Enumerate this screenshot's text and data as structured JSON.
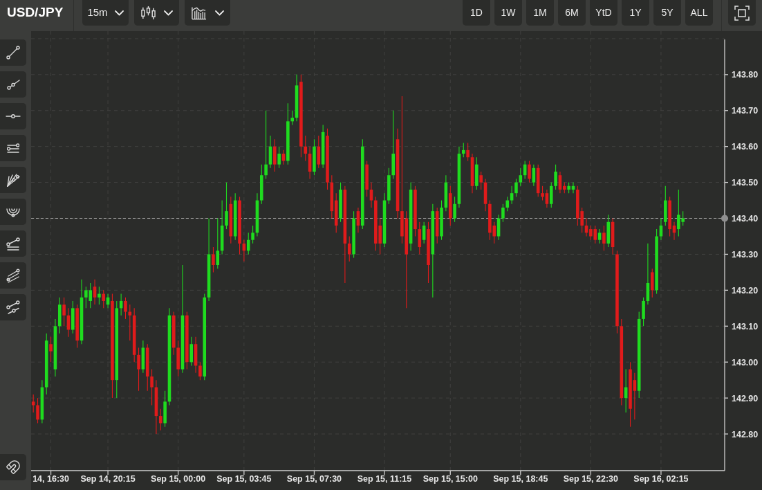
{
  "header": {
    "symbol": "USD/JPY",
    "interval": "15m",
    "ranges": [
      "1D",
      "1W",
      "1M",
      "6M",
      "YtD",
      "1Y",
      "5Y",
      "ALL"
    ]
  },
  "chart": {
    "chart_data": {
      "type": "candlestick",
      "grid": true,
      "ylim": [
        142.698,
        143.921
      ],
      "yticks": [
        {
          "value": 143.8,
          "label": "143.80"
        },
        {
          "value": 143.7,
          "label": "143.70"
        },
        {
          "value": 143.6,
          "label": "143.60"
        },
        {
          "value": 143.5,
          "label": "143.50"
        },
        {
          "value": 143.4,
          "label": "143.40"
        },
        {
          "value": 143.3,
          "label": "143.30"
        },
        {
          "value": 143.2,
          "label": "143.20"
        },
        {
          "value": 143.1,
          "label": "143.10"
        },
        {
          "value": 143.0,
          "label": "143.00"
        },
        {
          "value": 142.9,
          "label": "142.90"
        },
        {
          "value": 142.8,
          "label": "142.80"
        }
      ],
      "ref_lines": [
        {
          "axis": "y",
          "value": 143.4
        }
      ],
      "categories": [
        null,
        null,
        null,
        null,
        "14, 16:30",
        null,
        null,
        null,
        null,
        null,
        null,
        null,
        null,
        null,
        null,
        null,
        null,
        "Sep 14, 20:15",
        null,
        null,
        null,
        null,
        null,
        null,
        null,
        null,
        null,
        null,
        null,
        null,
        null,
        null,
        null,
        "Sep 15, 00:00",
        null,
        null,
        null,
        null,
        null,
        null,
        null,
        null,
        null,
        null,
        null,
        null,
        null,
        null,
        "Sep 15, 03:45",
        null,
        null,
        null,
        null,
        null,
        null,
        null,
        null,
        null,
        null,
        null,
        null,
        null,
        null,
        null,
        "Sep 15, 07:30",
        null,
        null,
        null,
        null,
        null,
        null,
        null,
        null,
        null,
        null,
        null,
        null,
        null,
        null,
        null,
        "Sep 15, 11:15",
        null,
        null,
        null,
        null,
        null,
        null,
        null,
        null,
        null,
        null,
        null,
        null,
        null,
        null,
        "Sep 15, 15:00",
        null,
        null,
        null,
        null,
        null,
        null,
        null,
        null,
        null,
        null,
        null,
        null,
        null,
        null,
        null,
        "Sep 15, 18:45",
        null,
        null,
        null,
        null,
        null,
        null,
        null,
        null,
        null,
        null,
        null,
        null,
        null,
        null,
        null,
        "Sep 15, 22:30",
        null,
        null,
        null,
        null,
        null,
        null,
        null,
        null,
        null,
        null,
        null,
        null,
        null,
        null,
        null,
        "Sep 16, 02:15",
        null,
        null,
        null,
        null,
        null,
        null,
        null,
        null,
        null,
        null,
        null,
        null,
        null,
        null
      ],
      "ohlc": [
        [
          142.89,
          142.91,
          142.86,
          142.88
        ],
        [
          142.88,
          142.9,
          142.83,
          142.84
        ],
        [
          142.84,
          142.95,
          142.83,
          142.93
        ],
        [
          142.93,
          143.08,
          142.91,
          143.06
        ],
        [
          143.05,
          143.07,
          143.0,
          143.03
        ],
        [
          142.98,
          143.12,
          142.96,
          143.1
        ],
        [
          143.1,
          143.18,
          143.08,
          143.16
        ],
        [
          143.16,
          143.18,
          143.1,
          143.13
        ],
        [
          143.13,
          143.15,
          143.07,
          143.09
        ],
        [
          143.09,
          143.17,
          143.08,
          143.15
        ],
        [
          143.15,
          143.16,
          143.04,
          143.06
        ],
        [
          143.06,
          143.23,
          143.05,
          143.18
        ],
        [
          143.18,
          143.21,
          143.15,
          143.2
        ],
        [
          143.17,
          143.22,
          143.15,
          143.2
        ],
        [
          143.21,
          143.23,
          143.16,
          143.18
        ],
        [
          143.18,
          143.21,
          143.16,
          143.19
        ],
        [
          143.19,
          143.2,
          143.15,
          143.17
        ],
        [
          143.16,
          143.19,
          143.15,
          143.18
        ],
        [
          143.17,
          143.19,
          142.9,
          142.95
        ],
        [
          142.95,
          143.17,
          142.9,
          143.15
        ],
        [
          143.15,
          143.19,
          143.13,
          143.17
        ],
        [
          143.17,
          143.18,
          143.12,
          143.14
        ],
        [
          143.14,
          143.16,
          143.06,
          143.13
        ],
        [
          143.13,
          143.15,
          143.0,
          143.02
        ],
        [
          143.02,
          143.04,
          142.92,
          142.98
        ],
        [
          142.98,
          143.06,
          142.97,
          143.04
        ],
        [
          143.04,
          143.05,
          142.92,
          142.96
        ],
        [
          142.96,
          142.98,
          142.88,
          142.93
        ],
        [
          142.93,
          142.95,
          142.8,
          142.85
        ],
        [
          142.85,
          142.87,
          142.81,
          142.83
        ],
        [
          142.83,
          142.92,
          142.82,
          142.89
        ],
        [
          142.89,
          143.15,
          142.88,
          143.13
        ],
        [
          143.13,
          143.14,
          143.02,
          143.04
        ],
        [
          143.04,
          143.06,
          142.96,
          142.98
        ],
        [
          142.98,
          143.27,
          142.97,
          143.13
        ],
        [
          143.13,
          143.14,
          142.98,
          143.0
        ],
        [
          143.0,
          143.07,
          142.99,
          143.05
        ],
        [
          143.05,
          143.07,
          142.97,
          142.99
        ],
        [
          142.99,
          143.0,
          142.95,
          142.96
        ],
        [
          142.96,
          143.19,
          142.95,
          143.18
        ],
        [
          143.18,
          143.4,
          143.17,
          143.3
        ],
        [
          143.3,
          143.32,
          143.25,
          143.27
        ],
        [
          143.27,
          143.4,
          143.26,
          143.31
        ],
        [
          143.31,
          143.45,
          143.3,
          143.38
        ],
        [
          143.38,
          143.5,
          143.37,
          143.42
        ],
        [
          143.44,
          143.46,
          143.33,
          143.35
        ],
        [
          143.35,
          143.47,
          143.34,
          143.45
        ],
        [
          143.45,
          143.46,
          143.3,
          143.33
        ],
        [
          143.33,
          143.34,
          143.28,
          143.31
        ],
        [
          143.31,
          143.36,
          143.3,
          143.34
        ],
        [
          143.34,
          143.38,
          143.33,
          143.36
        ],
        [
          143.36,
          143.47,
          143.35,
          143.45
        ],
        [
          143.45,
          143.55,
          143.44,
          143.52
        ],
        [
          143.52,
          143.7,
          143.51,
          143.55
        ],
        [
          143.55,
          143.63,
          143.54,
          143.6
        ],
        [
          143.6,
          143.62,
          143.53,
          143.55
        ],
        [
          143.55,
          143.6,
          143.54,
          143.58
        ],
        [
          143.58,
          143.59,
          143.55,
          143.56
        ],
        [
          143.56,
          143.72,
          143.55,
          143.67
        ],
        [
          143.67,
          143.7,
          143.66,
          143.68
        ],
        [
          143.68,
          143.8,
          143.67,
          143.77
        ],
        [
          143.78,
          143.8,
          143.57,
          143.6
        ],
        [
          143.6,
          143.63,
          143.56,
          143.58
        ],
        [
          143.58,
          143.6,
          143.51,
          143.53
        ],
        [
          143.53,
          143.62,
          143.52,
          143.6
        ],
        [
          143.6,
          143.63,
          143.54,
          143.55
        ],
        [
          143.55,
          143.66,
          143.54,
          143.64
        ],
        [
          143.63,
          143.65,
          143.48,
          143.5
        ],
        [
          143.5,
          143.52,
          143.4,
          143.42
        ],
        [
          143.45,
          143.47,
          143.36,
          143.38
        ],
        [
          143.4,
          143.5,
          143.39,
          143.48
        ],
        [
          143.48,
          143.49,
          143.22,
          143.33
        ],
        [
          143.33,
          143.35,
          143.28,
          143.3
        ],
        [
          143.3,
          143.42,
          143.29,
          143.4
        ],
        [
          143.42,
          143.43,
          143.36,
          143.38
        ],
        [
          143.38,
          143.62,
          143.37,
          143.6
        ],
        [
          143.55,
          143.56,
          143.46,
          143.48
        ],
        [
          143.48,
          143.5,
          143.43,
          143.45
        ],
        [
          143.45,
          143.46,
          143.31,
          143.33
        ],
        [
          143.38,
          143.4,
          143.3,
          143.33
        ],
        [
          143.33,
          143.47,
          143.32,
          143.45
        ],
        [
          143.45,
          143.54,
          143.44,
          143.52
        ],
        [
          143.52,
          143.7,
          143.51,
          143.58
        ],
        [
          143.62,
          143.65,
          143.4,
          143.42
        ],
        [
          143.42,
          143.74,
          143.33,
          143.35
        ],
        [
          143.4,
          143.42,
          143.15,
          143.3
        ],
        [
          143.33,
          143.5,
          143.31,
          143.48
        ],
        [
          143.48,
          143.49,
          143.35,
          143.37
        ],
        [
          143.37,
          143.39,
          143.3,
          143.32
        ],
        [
          143.34,
          143.39,
          143.33,
          143.38
        ],
        [
          143.37,
          143.39,
          143.22,
          143.27
        ],
        [
          143.3,
          143.44,
          143.18,
          143.42
        ],
        [
          143.42,
          143.43,
          143.33,
          143.35
        ],
        [
          143.35,
          143.45,
          143.34,
          143.43
        ],
        [
          143.43,
          143.52,
          143.42,
          143.5
        ],
        [
          143.47,
          143.49,
          143.38,
          143.4
        ],
        [
          143.4,
          143.46,
          143.39,
          143.44
        ],
        [
          143.44,
          143.6,
          143.43,
          143.58
        ],
        [
          143.58,
          143.61,
          143.57,
          143.59
        ],
        [
          143.59,
          143.61,
          143.56,
          143.57
        ],
        [
          143.57,
          143.58,
          143.47,
          143.49
        ],
        [
          143.49,
          143.57,
          143.48,
          143.55
        ],
        [
          143.52,
          143.53,
          143.48,
          143.5
        ],
        [
          143.5,
          143.51,
          143.42,
          143.44
        ],
        [
          143.44,
          143.45,
          143.34,
          143.36
        ],
        [
          143.38,
          143.39,
          143.33,
          143.35
        ],
        [
          143.35,
          143.41,
          143.34,
          143.4
        ],
        [
          143.4,
          143.44,
          143.39,
          143.43
        ],
        [
          143.43,
          143.46,
          143.42,
          143.45
        ],
        [
          143.45,
          143.49,
          143.44,
          143.47
        ],
        [
          143.47,
          143.51,
          143.46,
          143.5
        ],
        [
          143.5,
          143.54,
          143.49,
          143.52
        ],
        [
          143.52,
          143.56,
          143.51,
          143.55
        ],
        [
          143.55,
          143.56,
          143.5,
          143.51
        ],
        [
          143.5,
          143.55,
          143.49,
          143.54
        ],
        [
          143.54,
          143.55,
          143.46,
          143.47
        ],
        [
          143.47,
          143.49,
          143.45,
          143.46
        ],
        [
          143.47,
          143.48,
          143.43,
          143.44
        ],
        [
          143.44,
          143.5,
          143.43,
          143.49
        ],
        [
          143.49,
          143.55,
          143.48,
          143.53
        ],
        [
          143.52,
          143.53,
          143.47,
          143.48
        ],
        [
          143.49,
          143.5,
          143.47,
          143.48
        ],
        [
          143.48,
          143.5,
          143.47,
          143.49
        ],
        [
          143.48,
          143.5,
          143.47,
          143.49
        ],
        [
          143.48,
          143.49,
          143.38,
          143.4
        ],
        [
          143.42,
          143.43,
          143.36,
          143.38
        ],
        [
          143.38,
          143.4,
          143.35,
          143.36
        ],
        [
          143.37,
          143.38,
          143.34,
          143.35
        ],
        [
          143.37,
          143.38,
          143.33,
          143.34
        ],
        [
          143.34,
          143.37,
          143.33,
          143.36
        ],
        [
          143.36,
          143.38,
          143.31,
          143.33
        ],
        [
          143.33,
          143.41,
          143.32,
          143.39
        ],
        [
          143.39,
          143.4,
          143.3,
          143.32
        ],
        [
          143.3,
          143.31,
          143.08,
          143.1
        ],
        [
          143.1,
          143.12,
          142.88,
          142.9
        ],
        [
          142.9,
          142.98,
          142.86,
          142.93
        ],
        [
          142.98,
          143.0,
          142.82,
          142.87
        ],
        [
          142.95,
          142.97,
          142.84,
          142.92
        ],
        [
          142.92,
          143.14,
          142.9,
          143.12
        ],
        [
          143.12,
          143.18,
          143.1,
          143.17
        ],
        [
          143.17,
          143.33,
          143.16,
          143.22
        ],
        [
          143.25,
          143.26,
          143.18,
          143.2
        ],
        [
          143.2,
          143.37,
          143.19,
          143.35
        ],
        [
          143.35,
          143.4,
          143.34,
          143.38
        ],
        [
          143.39,
          143.49,
          143.38,
          143.45
        ],
        [
          143.45,
          143.46,
          143.35,
          143.37
        ],
        [
          143.38,
          143.39,
          143.34,
          143.36
        ],
        [
          143.37,
          143.48,
          143.35,
          143.41
        ],
        [
          143.39,
          143.42,
          143.38,
          143.4
        ],
        null,
        null,
        null,
        null,
        null,
        null,
        null,
        null,
        null
      ]
    }
  }
}
